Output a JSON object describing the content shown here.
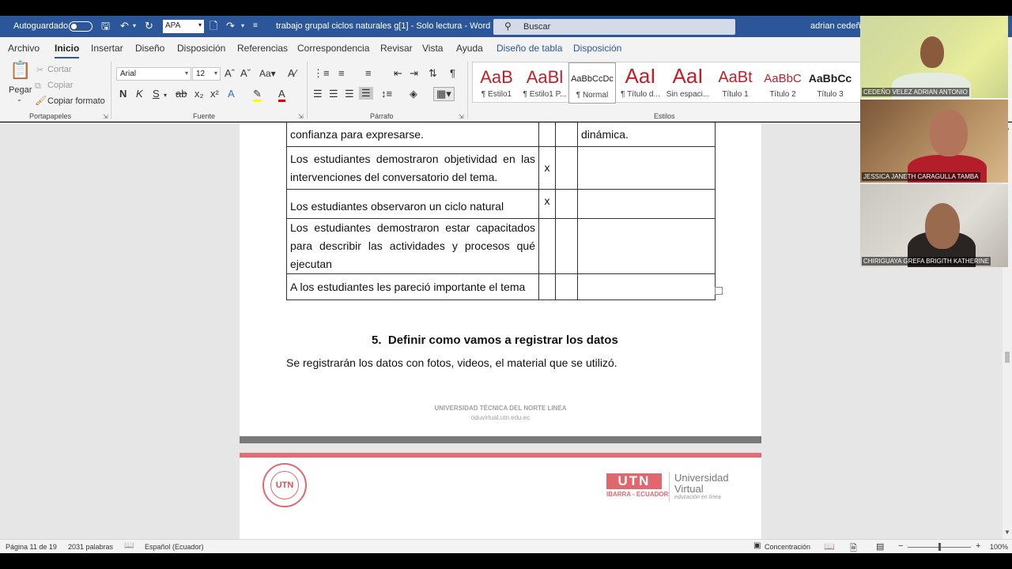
{
  "titlebar": {
    "autosave_label": "Autoguardado",
    "font_quick": "APA",
    "doc_title": "trabajo grupal ciclos naturales g[1]  -  Solo lectura  -  Word",
    "search_placeholder": "Buscar",
    "user": "adrian cedeño"
  },
  "menu": {
    "tabs": [
      "Archivo",
      "Inicio",
      "Insertar",
      "Diseño",
      "Disposición",
      "Referencias",
      "Correspondencia",
      "Revisar",
      "Vista",
      "Ayuda",
      "Diseño de tabla",
      "Disposición"
    ]
  },
  "ribbon": {
    "clipboard": {
      "paste": "Pegar",
      "cut": "Cortar",
      "copy": "Copiar",
      "format_painter": "Copiar formato",
      "group": "Portapapeles"
    },
    "font": {
      "name": "Arial",
      "size": "12",
      "group": "Fuente"
    },
    "paragraph": {
      "group": "Párrafo"
    },
    "styles": {
      "group": "Estilos",
      "items": [
        {
          "preview": "AaB",
          "name": "¶ Estilo1",
          "color": "#c0202a"
        },
        {
          "preview": "AaBl",
          "name": "¶ Estilo1 P...",
          "color": "#c0202a"
        },
        {
          "preview": "AaBbCcDc",
          "name": "¶ Normal",
          "color": "#222222"
        },
        {
          "preview": "AaI",
          "name": "¶ Título d...",
          "color": "#c0202a"
        },
        {
          "preview": "AaI",
          "name": "Sin espaci...",
          "color": "#c0202a"
        },
        {
          "preview": "AaBt",
          "name": "Título 1",
          "color": "#c0202a"
        },
        {
          "preview": "AaBbC",
          "name": "Título 2",
          "color": "#c0202a"
        },
        {
          "preview": "AaBbCc",
          "name": "Título 3",
          "color": "#222222"
        }
      ]
    }
  },
  "document": {
    "rows": [
      {
        "text": "confianza para expresarse.",
        "mark": "",
        "note": "dinámica."
      },
      {
        "text": "Los estudiantes demostraron objetividad en las intervenciones del conversatorio del tema.",
        "mark": "x",
        "note": ""
      },
      {
        "text": "Los estudiantes observaron un ciclo natural",
        "mark": "x",
        "note": ""
      },
      {
        "text": "Los estudiantes demostraron estar capacitados para describir las actividades y procesos qué ejecutan",
        "mark": "",
        "note": ""
      },
      {
        "text": "A los estudiantes les pareció importante el tema",
        "mark": "",
        "note": ""
      }
    ],
    "heading_number": "5.",
    "heading": "Definir como vamos a registrar los datos",
    "paragraph": "Se registrarán los datos con fotos, videos, el material que se utilizó.",
    "footer_line1": "UNIVERSIDAD TÉCNICA DEL NORTE LINEA",
    "footer_line2": "oduvirtual.utn.edu.ec",
    "logo_right": {
      "brand": "UTN",
      "sub": "IBARRA - ECUADOR",
      "title1": "Universidad",
      "title2": "Virtual",
      "tagline": "educación en línea"
    }
  },
  "status": {
    "page": "Página 11 de 19",
    "words": "2031 palabras",
    "language": "Español (Ecuador)",
    "focus": "Concentración",
    "zoom": "100%",
    "zoom_level": 1.0
  },
  "participants": [
    {
      "name": "CEDEÑO VELEZ ADRIAN ANTONIO"
    },
    {
      "name": "JESSICA JANETH CARAGULLA TAMBA"
    },
    {
      "name": "CHIRIGUAYA GREFA BRIGITH KATHERINE"
    }
  ]
}
